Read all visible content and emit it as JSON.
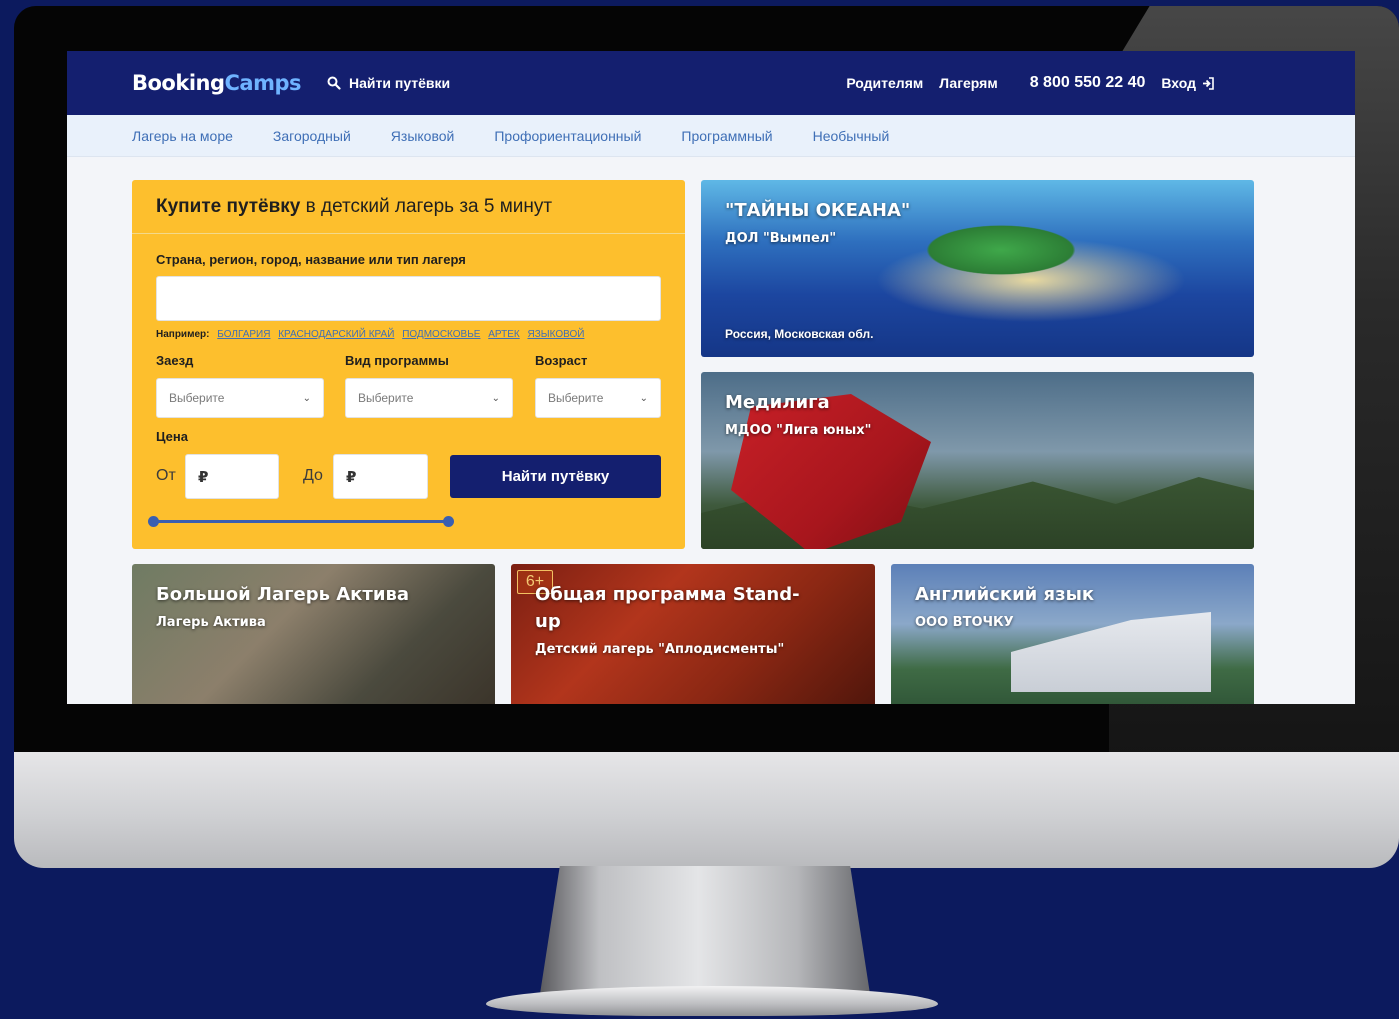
{
  "header": {
    "logo_part1": "Booking",
    "logo_part2": "Camps",
    "search_label": "Найти путёвки",
    "nav": [
      "Родителям",
      "Лагерям"
    ],
    "phone": "8 800 550 22 40",
    "login": "Вход"
  },
  "categories": [
    "Лагерь на море",
    "Загородный",
    "Языковой",
    "Профориентационный",
    "Программный",
    "Необычный"
  ],
  "search_form": {
    "title_bold": "Купите путёвку",
    "title_rest": " в детский лагерь за 5 минут",
    "location_label": "Страна, регион, город, название или тип лагеря",
    "location_value": "",
    "examples_label": "Например:",
    "examples": [
      "БОЛГАРИЯ",
      "КРАСНОДАРСКИЙ КРАЙ",
      "ПОДМОСКОВЬЕ",
      "АРТЕК",
      "ЯЗЫКОВОЙ"
    ],
    "checkin_label": "Заезд",
    "program_label": "Вид программы",
    "age_label": "Возраст",
    "select_placeholder": "Выберите",
    "price_label": "Цена",
    "price_from_label": "От",
    "price_to_label": "До",
    "currency": "₽",
    "submit_label": "Найти путёвку"
  },
  "cards": {
    "ocean": {
      "title": "\"ТАЙНЫ ОКЕАНА\"",
      "subtitle": "ДОЛ \"Вымпел\"",
      "location": "Россия, Московская обл."
    },
    "mediliga": {
      "title": "Медилига",
      "subtitle": "МДОО \"Лига юных\""
    },
    "active": {
      "title": "Большой Лагерь Актива",
      "subtitle": "Лагерь Актива"
    },
    "standup": {
      "age": "6+",
      "title_line1": "Общая программа Stand-",
      "title_line2": "up",
      "subtitle": "Детский лагерь \"Аплодисменты\""
    },
    "english": {
      "title": "Английский язык",
      "subtitle": "ООО ВТОЧКУ"
    }
  },
  "colors": {
    "page_bg": "#0c1a5e",
    "header_bg": "#141f6f",
    "accent_yellow": "#fdbf2d",
    "link_blue": "#3f6fb6",
    "logo_accent": "#6fb3ff"
  }
}
